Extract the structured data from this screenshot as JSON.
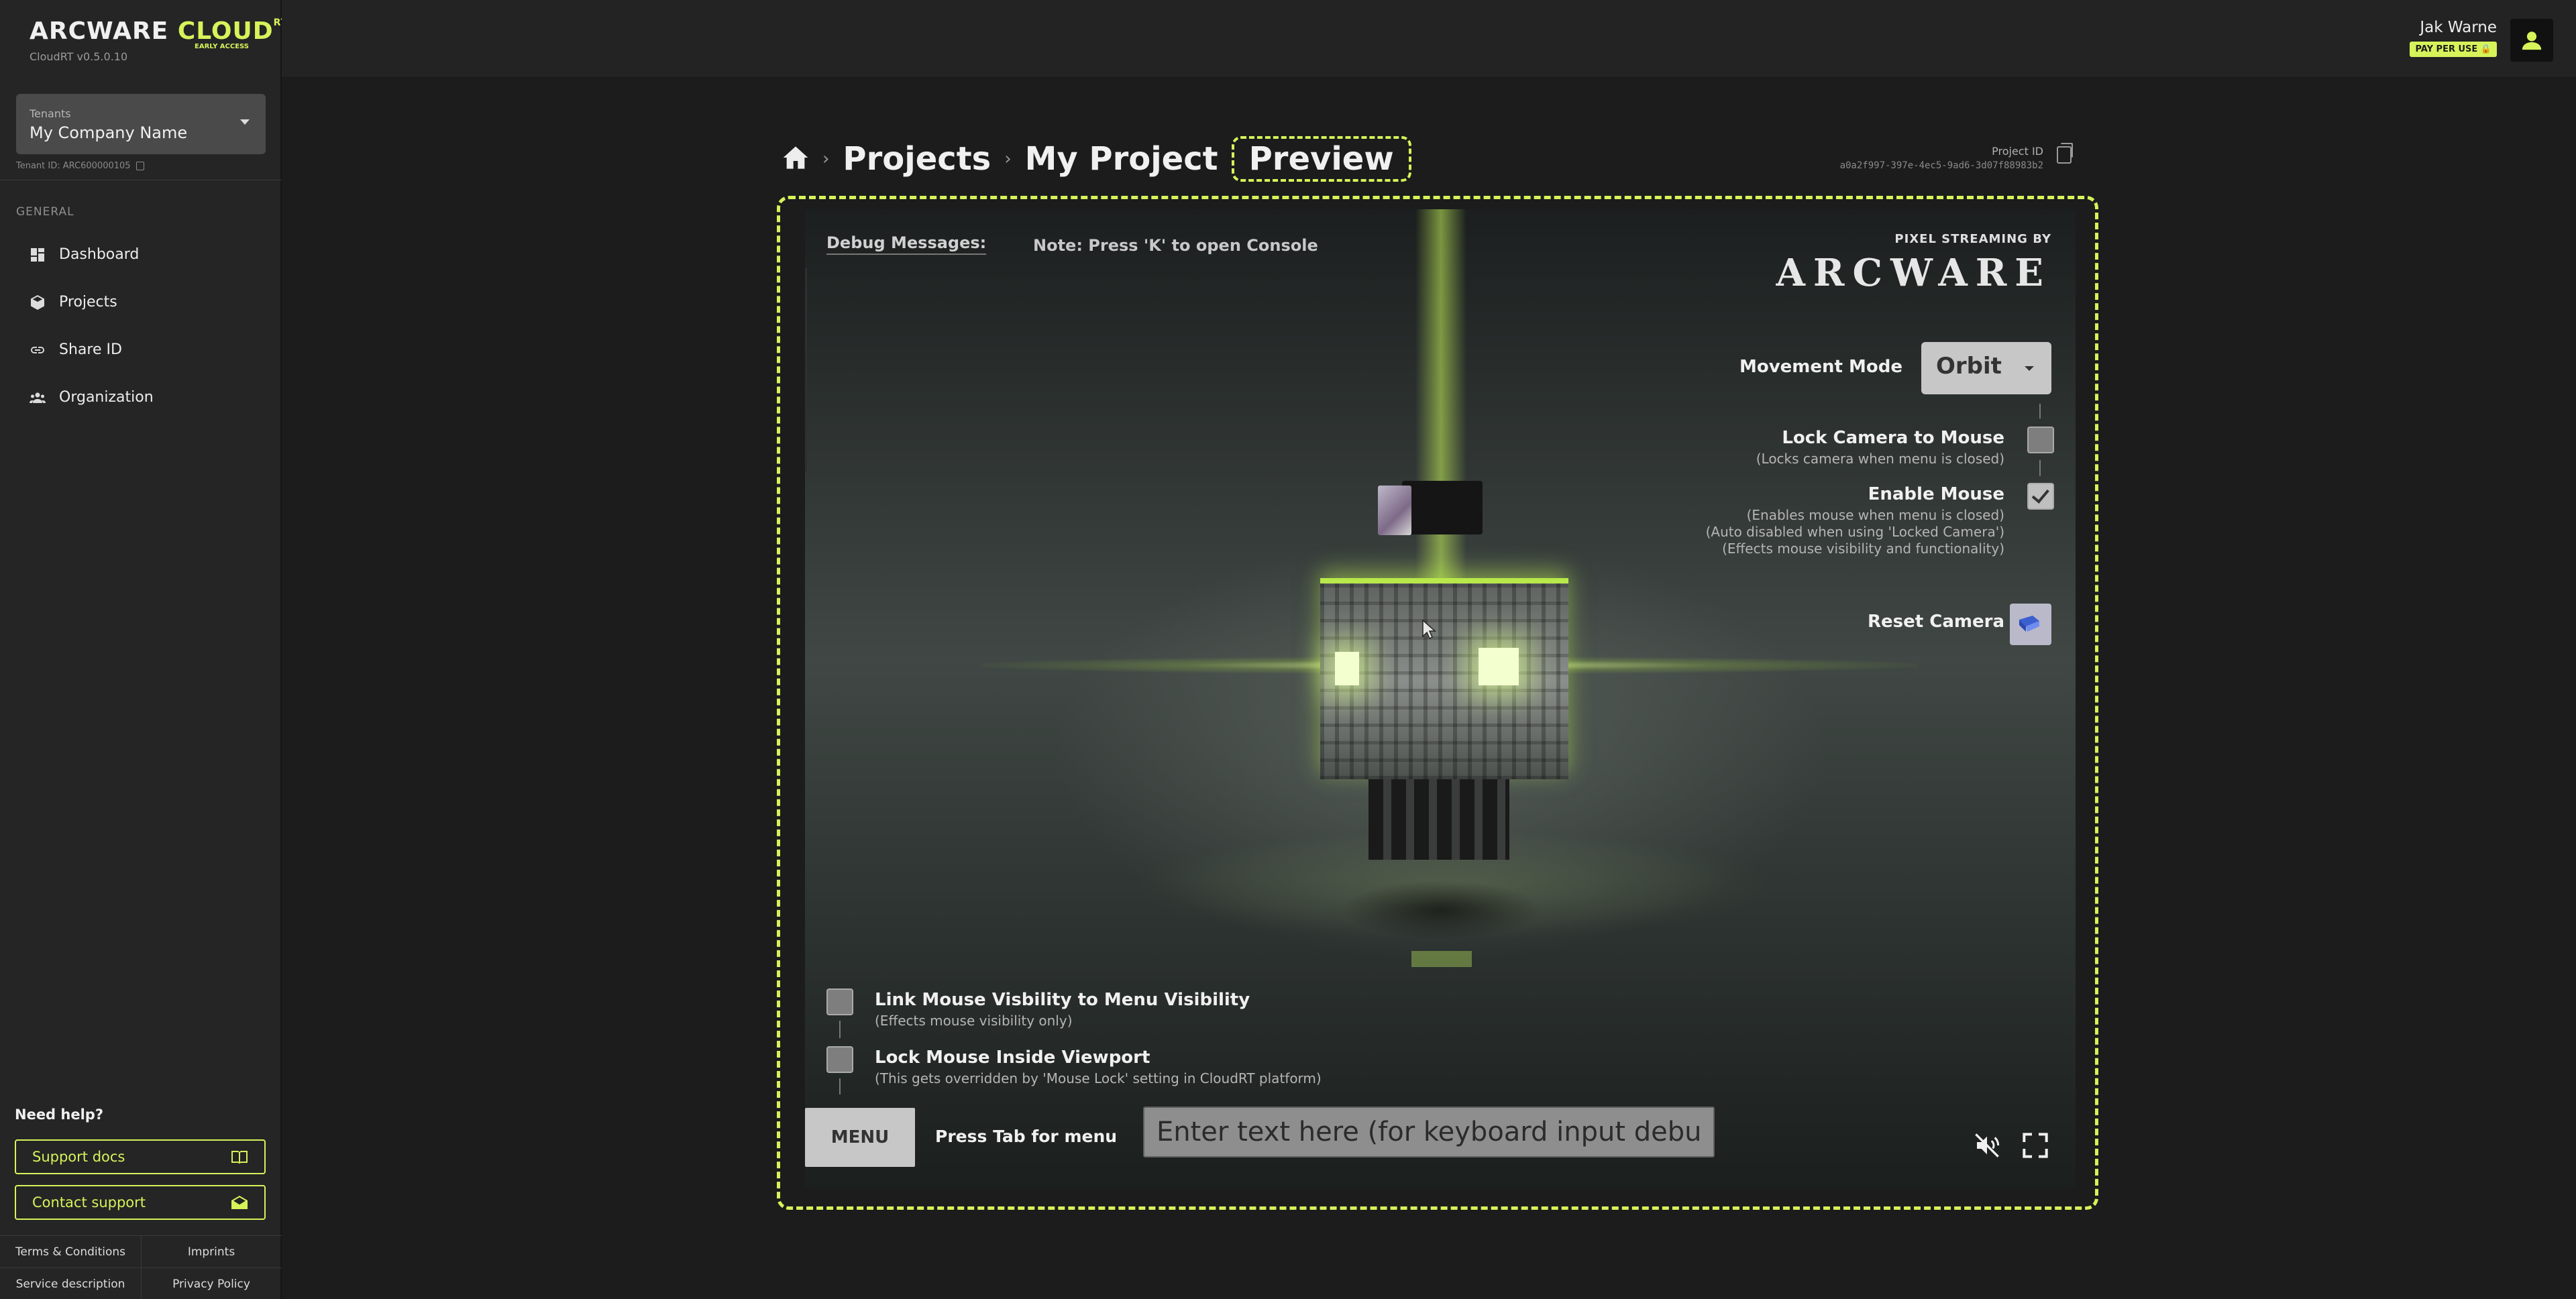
{
  "brand": {
    "name_a": "ARCWARE ",
    "name_b": "CLOUD",
    "name_sup": "RT",
    "early_access": "EARLY ACCESS",
    "version": "CloudRT v0.5.0.10"
  },
  "tenant": {
    "label": "Tenants",
    "value": "My Company Name",
    "id_text": "Tenant ID: ARC600000105"
  },
  "sidebar": {
    "section_label": "GENERAL",
    "items": [
      {
        "label": "Dashboard",
        "icon": "dashboard-icon"
      },
      {
        "label": "Projects",
        "icon": "cube-icon"
      },
      {
        "label": "Share ID",
        "icon": "link-icon"
      },
      {
        "label": "Organization",
        "icon": "people-icon"
      }
    ],
    "help_title": "Need help?",
    "support_docs": "Support docs",
    "contact_support": "Contact support",
    "footer": {
      "terms": "Terms & Conditions",
      "imprints": "Imprints",
      "service": "Service description",
      "privacy": "Privacy Policy"
    }
  },
  "topbar": {
    "user_name": "Jak Warne",
    "badge": "PAY PER USE 🔒"
  },
  "breadcrumb": {
    "sep": "›",
    "projects": "Projects",
    "project": "My Project",
    "current": "Preview"
  },
  "project_id": {
    "label": "Project ID",
    "value": "a0a2f997-397e-4ec5-9ad6-3d07f88983b2"
  },
  "viewport": {
    "debug_label": "Debug Messages:",
    "debug_note": "Note: Press 'K' to open Console",
    "ps_by": "PIXEL STREAMING BY",
    "ps_logo": "ARCWARE",
    "movement_label": "Movement Mode",
    "movement_value": "Orbit",
    "lock_camera": {
      "title": "Lock Camera to Mouse",
      "desc": "(Locks camera when menu is closed)",
      "checked": false
    },
    "enable_mouse": {
      "title": "Enable Mouse",
      "desc1": "(Enables mouse when menu is closed)",
      "desc2": "(Auto disabled when using 'Locked Camera')",
      "desc3": "(Effects mouse visibility and functionality)",
      "checked": true
    },
    "reset_camera": "Reset Camera",
    "link_mouse": {
      "title": "Link Mouse Visbility to Menu Visibility",
      "desc": "(Effects mouse visibility only)"
    },
    "lock_mouse": {
      "title": "Lock Mouse Inside Viewport",
      "desc": "(This gets overridden by 'Mouse Lock' setting in CloudRT platform)"
    },
    "menu_label": "MENU",
    "tab_hint": "Press Tab for menu",
    "input_placeholder": "Enter text here (for keyboard input debug)"
  },
  "colors": {
    "accent": "#d6f35a",
    "background": "#1c1c1c",
    "sidebar": "#252525"
  }
}
